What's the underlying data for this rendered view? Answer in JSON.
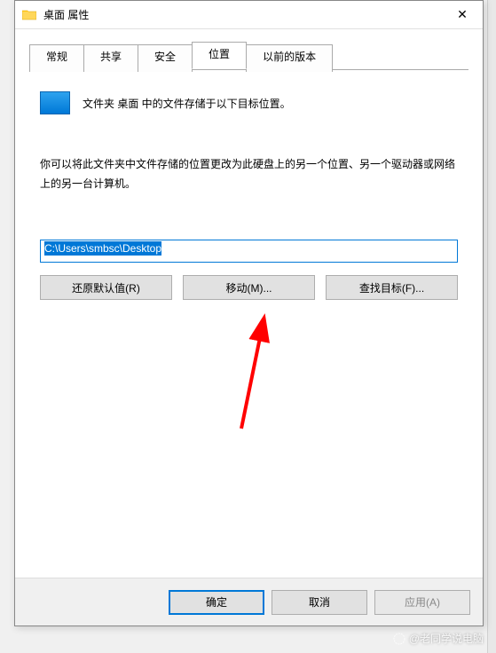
{
  "titlebar": {
    "title": "桌面 属性"
  },
  "tabs": {
    "items": [
      {
        "label": "常规"
      },
      {
        "label": "共享"
      },
      {
        "label": "安全"
      },
      {
        "label": "位置"
      },
      {
        "label": "以前的版本"
      }
    ],
    "activeIndex": 3
  },
  "content": {
    "line1": "文件夹 桌面 中的文件存储于以下目标位置。",
    "line2": "你可以将此文件夹中文件存储的位置更改为此硬盘上的另一个位置、另一个驱动器或网络上的另一台计算机。",
    "path": "C:\\Users\\smbsc\\Desktop",
    "buttons": {
      "restore": "还原默认值(R)",
      "move": "移动(M)...",
      "find": "查找目标(F)..."
    }
  },
  "footer": {
    "ok": "确定",
    "cancel": "取消",
    "apply": "应用(A)"
  },
  "watermark": "@老同学说电脑"
}
